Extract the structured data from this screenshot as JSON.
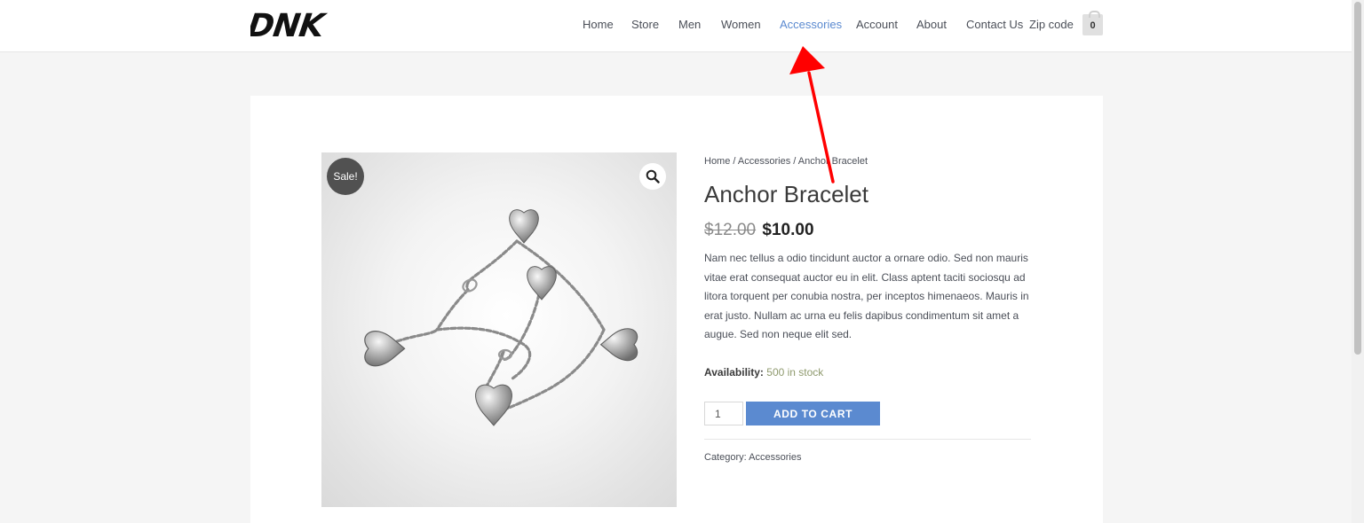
{
  "brand": {
    "logo_text": "DNK"
  },
  "nav": {
    "items": [
      {
        "label": "Home"
      },
      {
        "label": "Store"
      },
      {
        "label": "Men"
      },
      {
        "label": "Women"
      },
      {
        "label": "Accessories",
        "active": true
      },
      {
        "label": "Account"
      },
      {
        "label": "About"
      },
      {
        "label": "Contact Us"
      },
      {
        "label": "Zip code"
      }
    ],
    "cart_count": "0"
  },
  "product": {
    "sale_badge": "Sale!",
    "breadcrumb": {
      "home": "Home",
      "sep": " / ",
      "category": "Accessories",
      "current": "Anchor Bracelet"
    },
    "title": "Anchor Bracelet",
    "old_price": "$12.00",
    "price": "$10.00",
    "description": "Nam nec tellus a odio tincidunt auctor a ornare odio. Sed non mauris vitae erat consequat auctor eu in elit. Class aptent taciti sociosqu ad litora torquent per conubia nostra, per inceptos himenaeos. Mauris in erat justo. Nullam ac urna eu felis dapibus condimentum sit amet a augue. Sed non neque elit sed.",
    "availability_label": "Availability:",
    "availability_value": "500 in stock",
    "quantity": "1",
    "add_to_cart": "Add to cart",
    "category_label": "Category:",
    "category_value": "Accessories"
  },
  "icons": {
    "zoom": "magnifier-icon",
    "cart": "cart-icon",
    "annotation": "red-arrow-icon"
  },
  "colors": {
    "accent": "#5b8ad0",
    "sale_badge": "#515151",
    "annotation_arrow": "#ff0000",
    "stock": "#8f9a6e"
  }
}
